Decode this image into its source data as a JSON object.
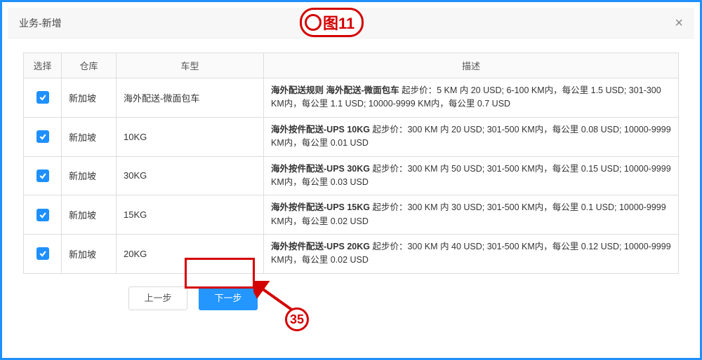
{
  "dialog": {
    "title": "业务-新增",
    "close_glyph": "×"
  },
  "table": {
    "headers": {
      "select": "选择",
      "warehouse": "仓库",
      "vehicle": "车型",
      "desc": "描述"
    },
    "rows": [
      {
        "checked": true,
        "warehouse": "新加坡",
        "vehicle": "海外配送-微面包车",
        "desc_strong": "海外配送规则 海外配送-微面包车",
        "desc_rest": " 起步价：5 KM 内 20 USD; 6-100 KM内，每公里 1.5 USD; 301-300 KM内，每公里 1.1 USD; 10000-9999 KM内，每公里 0.7 USD"
      },
      {
        "checked": true,
        "warehouse": "新加坡",
        "vehicle": "10KG",
        "desc_strong": "海外按件配送-UPS 10KG",
        "desc_rest": " 起步价：300 KM 内 20 USD; 301-500 KM内，每公里 0.08 USD; 10000-9999 KM内，每公里 0.01 USD"
      },
      {
        "checked": true,
        "warehouse": "新加坡",
        "vehicle": "30KG",
        "desc_strong": "海外按件配送-UPS 30KG",
        "desc_rest": " 起步价：300 KM 内 50 USD; 301-500 KM内，每公里 0.15 USD; 10000-9999 KM内，每公里 0.03 USD"
      },
      {
        "checked": true,
        "warehouse": "新加坡",
        "vehicle": "15KG",
        "desc_strong": "海外按件配送-UPS 15KG",
        "desc_rest": " 起步价：300 KM 内 30 USD; 301-500 KM内，每公里 0.1 USD; 10000-9999 KM内，每公里 0.02 USD"
      },
      {
        "checked": true,
        "warehouse": "新加坡",
        "vehicle": "20KG",
        "desc_strong": "海外按件配送-UPS 20KG",
        "desc_rest": " 起步价：300 KM 内 40 USD; 301-500 KM内，每公里 0.12 USD; 10000-9999 KM内，每公里 0.02 USD"
      }
    ]
  },
  "buttons": {
    "prev": "上一步",
    "next": "下一步"
  },
  "annotations": {
    "figure_label": "图11",
    "step_number": "35"
  }
}
